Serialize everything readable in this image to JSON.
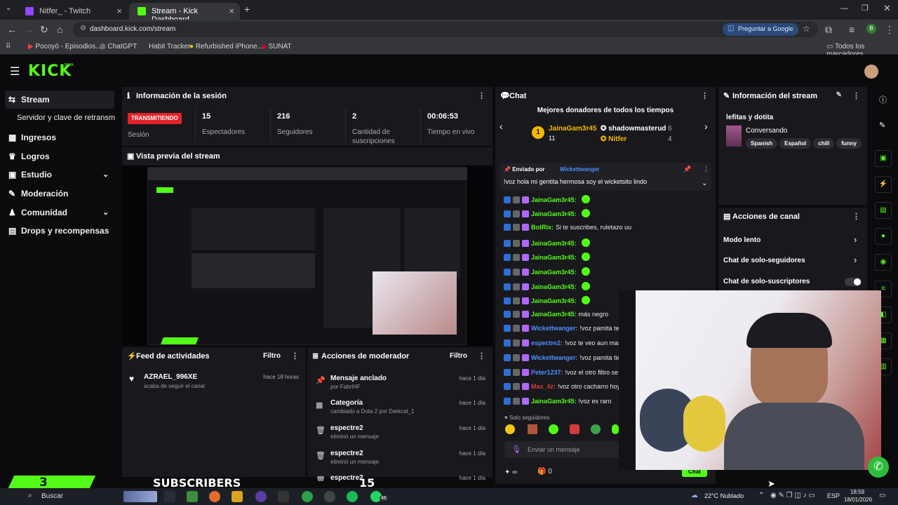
{
  "browser": {
    "tabs": [
      {
        "title": "Nitfer_ - Twitch",
        "color": "#9146ff"
      },
      {
        "title": "Stream - Kick Dashboard",
        "color": "#53fc18"
      }
    ],
    "url": "dashboard.kick.com/stream",
    "ask_google": "Preguntar a Google",
    "bookmarks": [
      "Pocoyó - Episodios...",
      "ChatGPT",
      "Habit Tracker",
      "Refurbished iPhone...",
      "SUNAT"
    ],
    "all_bookmarks": "Todos los marcadores"
  },
  "kick": {
    "logo": "KICK",
    "beta": "BETA",
    "accent": "#53fc18"
  },
  "sidebar": {
    "items": [
      {
        "label": "Stream",
        "icon": "↔"
      },
      {
        "label": "Servidor y clave de retransm",
        "icon": ""
      },
      {
        "label": "Ingresos",
        "icon": "▦"
      },
      {
        "label": "Logros",
        "icon": "🏆"
      },
      {
        "label": "Estudio",
        "icon": "▣"
      },
      {
        "label": "Moderación",
        "icon": "✎"
      },
      {
        "label": "Comunidad",
        "icon": "♟"
      },
      {
        "label": "Drops y recompensas",
        "icon": "▤"
      }
    ]
  },
  "session": {
    "title": "Información de la sesión",
    "live_badge": "TRANSMITIENDO",
    "session_label": "Sesión",
    "stats": [
      {
        "value": "15",
        "label": "Espectadores"
      },
      {
        "value": "216",
        "label": "Seguidores"
      },
      {
        "value": "2",
        "label": "Cantidad de suscripciones"
      },
      {
        "value": "00:06:53",
        "label": "Tiempo en vivo"
      }
    ]
  },
  "preview": {
    "title": "Vista previa del stream"
  },
  "activity": {
    "title": "Feed de actividades",
    "filter": "Filtro",
    "items": [
      {
        "user": "AZRAEL_996XE",
        "action": "acaba de seguir el canal",
        "time": "hace 18 horas"
      }
    ]
  },
  "modactions": {
    "title": "Acciones de moderador",
    "filter": "Filtro",
    "items": [
      {
        "title": "Mensaje anclado",
        "sub": "por FabriHF",
        "time": "hace 1 día",
        "icon": "📌"
      },
      {
        "title": "Categoría",
        "sub": "cambiado a Dota 2 por Darkcat_1",
        "time": "hace 1 día",
        "icon": "▦"
      },
      {
        "title": "espectre2",
        "sub": "eliminó un mensaje",
        "time": "hace 1 día",
        "icon": "🗑"
      },
      {
        "title": "espectre2",
        "sub": "eliminó un mensaje",
        "time": "hace 1 día",
        "icon": "🗑"
      },
      {
        "title": "espectre2",
        "sub": "",
        "time": "hace 1 día",
        "icon": "🗑"
      }
    ]
  },
  "chat": {
    "title": "Chat",
    "top_donors_title": "Mejores donadores de todos los tiempos",
    "donors": [
      {
        "rank": "1",
        "name": "JainaGam3r45",
        "amount": "11"
      },
      {
        "rank": "",
        "name": "shadowmasterud",
        "amount": "6"
      },
      {
        "rank": "",
        "name": "Nitfer",
        "amount": "4"
      }
    ],
    "pinned_by_label": "Enviado por",
    "pinned_by": "Wickettwanger",
    "pinned_msg": "!voz hola mi gentita hermosa soy el wicketsito lindo",
    "messages": [
      {
        "user": "JainaGam3r45:",
        "text": "",
        "color": "#53fc18"
      },
      {
        "user": "JainaGam3r45:",
        "text": "",
        "color": "#53fc18"
      },
      {
        "user": "BotRix:",
        "text": "Si te suscribes, ruletazo uu",
        "color": "#53fc18"
      },
      {
        "user": "JainaGam3r45:",
        "text": "",
        "color": "#53fc18"
      },
      {
        "user": "JainaGam3r45:",
        "text": "",
        "color": "#53fc18"
      },
      {
        "user": "JainaGam3r45:",
        "text": "",
        "color": "#53fc18"
      },
      {
        "user": "JainaGam3r45:",
        "text": "",
        "color": "#53fc18"
      },
      {
        "user": "JainaGam3r45:",
        "text": "",
        "color": "#53fc18"
      },
      {
        "user": "JainaGam3r45:",
        "text": "más negro",
        "color": "#53fc18"
      },
      {
        "user": "Wickettwanger:",
        "text": "!voz pamita te q",
        "color": "#4d8fff"
      },
      {
        "user": "espectre2:",
        "text": "!voz te veo aun mas negi",
        "color": "#4d8fff"
      },
      {
        "user": "Wickettwanger:",
        "text": "!voz pamita tien",
        "color": "#4d8fff"
      },
      {
        "user": "Peter1237:",
        "text": "!voz el otro filtro se te quito",
        "color": "#4d8fff"
      },
      {
        "user": "Max_4z:",
        "text": "!voz otro cacharro hoy",
        "color": "#d63b3b"
      },
      {
        "user": "JainaGam3r45:",
        "text": "!voz es raro",
        "color": "#53fc18"
      }
    ],
    "followers_only": "Solo seguidores",
    "input_placeholder": "Enviar un mensaje",
    "infinity": "∞",
    "count": "0",
    "send": "Chat"
  },
  "stream_info": {
    "title": "Información del stream",
    "stream_title": "lefitas y dotita",
    "category": "Conversando",
    "tags": [
      "Spanish",
      "Español",
      "chill",
      "funny"
    ]
  },
  "channel_actions": {
    "title": "Acciones de canal",
    "items": [
      "Modo lento",
      "Chat de solo-seguidores",
      "Chat de solo-suscriptores"
    ]
  },
  "overlay": {
    "sub_count": "3",
    "sub_label": "SUBSCRIBERS",
    "sub_viewers": "15"
  },
  "taskbar": {
    "search": "Buscar",
    "weather": "22°C Nublado",
    "lang": "ESP",
    "time": "18:59",
    "date": "18/01/2026",
    "badge": "46"
  }
}
